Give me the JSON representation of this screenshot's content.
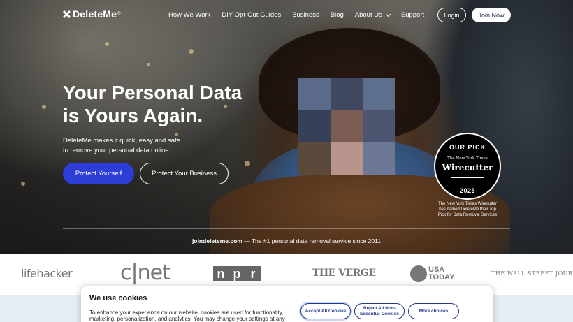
{
  "nav": {
    "logo": "DeleteMe",
    "logo_mark": "®",
    "links": [
      "How We Work",
      "DIY Opt-Out Guides",
      "Business",
      "Blog",
      "About Us",
      "Support"
    ],
    "login": "Login",
    "join": "Join Now"
  },
  "hero": {
    "headline_line1": "Your Personal Data",
    "headline_line2": "is Yours Again.",
    "subtext_line1": "DeleteMe makes it quick, easy and safe",
    "subtext_line2": "to remove your personal data online.",
    "cta_primary": "Protect Yourself",
    "cta_secondary": "Protect Your Business",
    "tagline_domain": "joindeleteme.com",
    "tagline_rest": " — The #1 personal data removal service since 2011"
  },
  "badge": {
    "top": "OUR PICK",
    "publication": "The New York Times",
    "name": "Wirecutter",
    "year": "2025",
    "caption_line1": "The New York Times Wirecutter",
    "caption_line2": "has named DeleteMe their Top",
    "caption_line3": "Pick for Data Removal Services"
  },
  "press": {
    "lifehacker": "lifehacker",
    "cnet": "c|net",
    "npr": [
      "n",
      "p",
      "r"
    ],
    "verge": "THE VERGE",
    "usa_line1": "USA",
    "usa_line2": "TODAY",
    "wsj": "THE WALL STREET JOURNAL"
  },
  "cookie": {
    "title": "We use cookies",
    "text": "To enhance your experience on our website, cookies are used for functionality, marketing, personalization, and analytics. You may change your settings at any time or",
    "accept": "Accept All Cookies",
    "reject_line1": "Reject All Non-",
    "reject_line2": "Essential Cookies",
    "more": "More choices"
  },
  "colors": {
    "primary_button": "#2c3ed6",
    "cookie_accent": "#1e3a8a",
    "below_bg": "#e7edf5"
  }
}
